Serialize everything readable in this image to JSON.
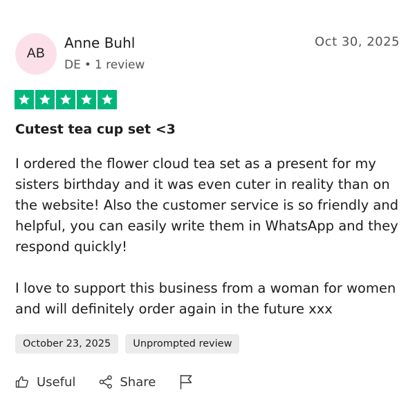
{
  "reviewer": {
    "initials": "AB",
    "name": "Anne Buhl",
    "country": "DE",
    "separator": "•",
    "review_count": "1 review",
    "avatar_color": "#fbe0ea"
  },
  "review": {
    "date": "Oct 30, 2025",
    "rating": 5,
    "max_rating": 5,
    "star_color": "#00b67a",
    "title": "Cutest tea cup set <3",
    "body_paragraphs": [
      "I ordered the flower cloud tea set as a present for my sisters birthday and it was even cuter in reality than on the website! Also the customer service is so friendly and helpful, you can easily write them in WhatsApp and they respond quickly!",
      "I love to support this business from a woman for women and will definitely order again in the future xxx"
    ],
    "tags": [
      "October 23, 2025",
      "Unprompted review"
    ]
  },
  "actions": {
    "useful_label": "Useful",
    "share_label": "Share",
    "useful_icon": "thumbs-up-icon",
    "share_icon": "share-icon",
    "report_icon": "flag-icon"
  }
}
